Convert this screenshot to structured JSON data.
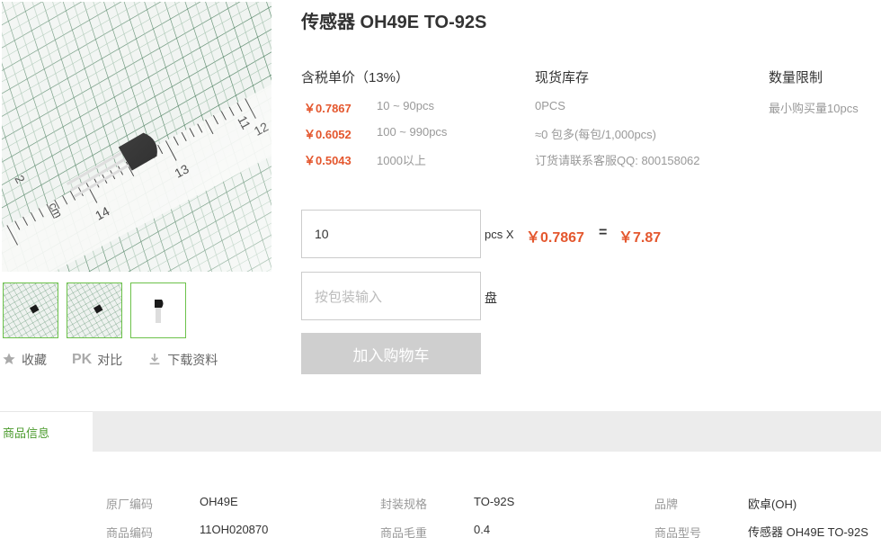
{
  "product": {
    "title": "传感器 OH49E TO-92S"
  },
  "gallery": {
    "thumbs": [
      "product-photo-ruler-1",
      "product-photo-ruler-2",
      "product-photo-component"
    ],
    "ruler_marks": [
      "11",
      "12",
      "13",
      "14",
      "2",
      "cm"
    ]
  },
  "actions": {
    "favorite": "收藏",
    "compare_badge": "PK",
    "compare": "对比",
    "download": "下载资料"
  },
  "pricing": {
    "header": "含税单价（13%）",
    "tiers": [
      {
        "price": "￥0.7867",
        "range": "10 ~ 90pcs"
      },
      {
        "price": "￥0.6052",
        "range": "100 ~ 990pcs"
      },
      {
        "price": "￥0.5043",
        "range": "1000以上"
      }
    ]
  },
  "stock": {
    "header": "现货库存",
    "lines": [
      "0PCS",
      "≈0 包多(每包/1,000pcs)",
      "订货请联系客服QQ: 800158062"
    ]
  },
  "limit": {
    "header": "数量限制",
    "line": "最小购买量10pcs"
  },
  "order": {
    "quantity_value": "10",
    "unit_label": "pcs X",
    "unit_price": "￥0.7867",
    "equals": "=",
    "total": "￥7.87",
    "pack_placeholder": "按包装输入",
    "pack_unit": "盘",
    "add_to_cart": "加入购物车"
  },
  "tabs": {
    "active": "商品信息"
  },
  "specs": [
    [
      {
        "k": "原厂编码",
        "v": "OH49E"
      },
      {
        "k": "封装规格",
        "v": "TO-92S"
      },
      {
        "k": "品牌",
        "v": "欧卓(OH)"
      }
    ],
    [
      {
        "k": "商品编码",
        "v": "11OH020870"
      },
      {
        "k": "商品毛重",
        "v": "0.4"
      },
      {
        "k": "商品型号",
        "v": "传感器 OH49E TO-92S"
      }
    ]
  ],
  "colors": {
    "price": "#e4572e",
    "accent_green": "#6cc24a",
    "button_disabled": "#cfcfcf"
  }
}
